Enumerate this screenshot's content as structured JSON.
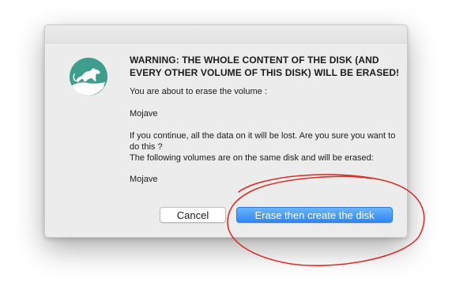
{
  "dialog": {
    "warning_title": "WARNING: THE WHOLE CONTENT OF THE DISK (AND EVERY OTHER VOLUME OF THIS DISK) WILL BE ERASED!",
    "line_about": "You are about to erase the volume :",
    "volume_name": "Mojave",
    "line_continue": "If you continue, all the data on it will be lost. Are you sure you want to do this ?",
    "line_following": "The following volumes are on the same disk and will be erased:",
    "affected_volume": "Mojave"
  },
  "buttons": {
    "cancel_label": "Cancel",
    "confirm_label": "Erase then create the disk"
  },
  "icons": {
    "app_icon": "mojave-panther-icon"
  },
  "annotation": {
    "shape": "red-hand-drawn-ellipse",
    "color": "#d9302b"
  },
  "colors": {
    "accent": "#2f88f6",
    "dialog_bg": "#ececec",
    "icon_teal": "#3e9e8e"
  }
}
